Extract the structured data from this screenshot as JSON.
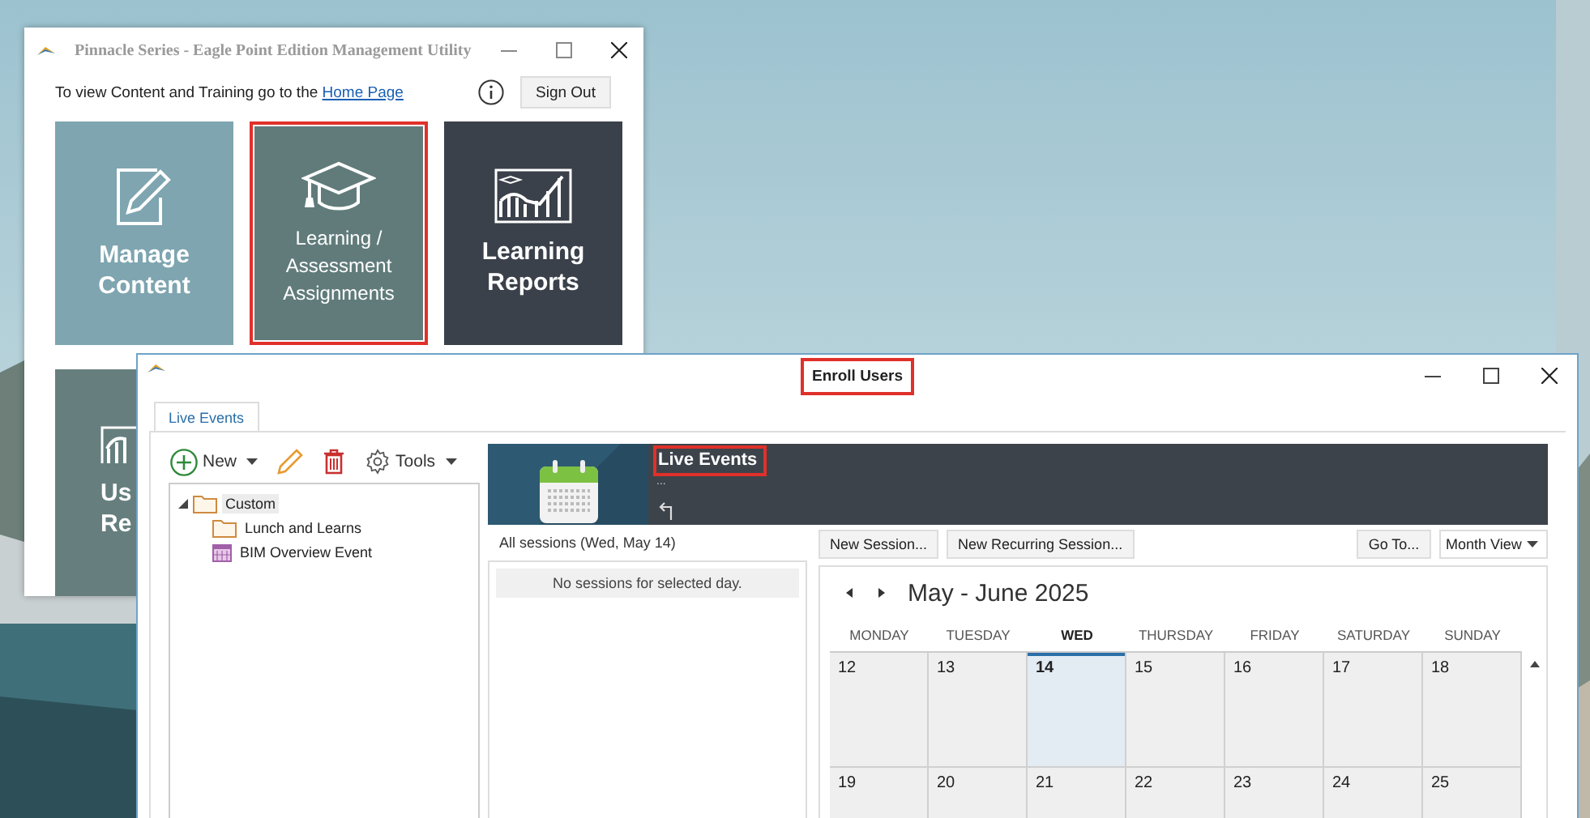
{
  "main_window": {
    "title": "Pinnacle Series - Eagle Point Edition Management Utility",
    "intro": "To view Content and Training go to the ",
    "intro_link": "Home Page",
    "sign_out": "Sign Out",
    "tiles": [
      {
        "kind": "edit",
        "lines": [
          "Manage",
          "Content"
        ],
        "highlighted": false
      },
      {
        "kind": "learning",
        "lines": [
          "Learning /",
          "Assessment",
          "Assignments"
        ],
        "highlighted": true
      },
      {
        "kind": "reports",
        "lines": [
          "Learning",
          "Reports"
        ],
        "highlighted": false
      },
      {
        "kind": "chart",
        "lines": [
          "Us",
          "Re"
        ],
        "highlighted": false
      }
    ]
  },
  "enroll_window": {
    "title": "Enroll Users",
    "title_highlighted": true,
    "tabs": [
      {
        "label": "Live Events",
        "selected": true
      }
    ],
    "toolbar": {
      "new": "New",
      "tools": "Tools"
    },
    "tree": [
      {
        "kind": "folder",
        "label": "Custom",
        "selected": true,
        "expanded": true,
        "children": [
          {
            "kind": "folder",
            "label": "Lunch and Learns",
            "selected": false
          },
          {
            "kind": "event",
            "label": "BIM Overview Event",
            "selected": false
          }
        ]
      }
    ],
    "header": {
      "title": "Live Events",
      "title_highlighted": true,
      "subtitle": "..."
    },
    "sessions": {
      "label": "All sessions (Wed, May 14)",
      "empty": "No sessions for selected day."
    },
    "calendar": {
      "buttons": [
        "New Session...",
        "New Recurring Session..."
      ],
      "goto": "Go To...",
      "view": "Month View",
      "title": "May - June 2025",
      "weekdays": [
        {
          "label": "MONDAY",
          "selected": false
        },
        {
          "label": "TUESDAY",
          "selected": false
        },
        {
          "label": "WED",
          "selected": true
        },
        {
          "label": "THURSDAY",
          "selected": false
        },
        {
          "label": "FRIDAY",
          "selected": false
        },
        {
          "label": "SATURDAY",
          "selected": false
        },
        {
          "label": "SUNDAY",
          "selected": false
        }
      ],
      "weeks": [
        [
          {
            "day": "12",
            "selected": false
          },
          {
            "day": "13",
            "selected": false
          },
          {
            "day": "14",
            "selected": true
          },
          {
            "day": "15",
            "selected": false
          },
          {
            "day": "16",
            "selected": false
          },
          {
            "day": "17",
            "selected": false
          },
          {
            "day": "18",
            "selected": false
          }
        ],
        [
          {
            "day": "19",
            "selected": false
          },
          {
            "day": "20",
            "selected": false
          },
          {
            "day": "21",
            "selected": false
          },
          {
            "day": "22",
            "selected": false
          },
          {
            "day": "23",
            "selected": false
          },
          {
            "day": "24",
            "selected": false
          },
          {
            "day": "25",
            "selected": false
          }
        ]
      ]
    }
  }
}
